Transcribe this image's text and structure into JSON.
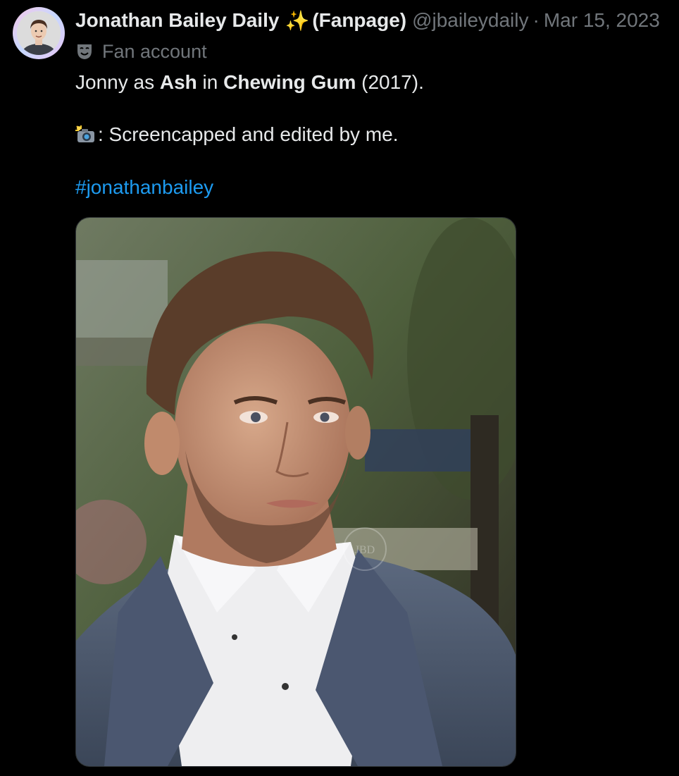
{
  "tweet": {
    "display_name": "Jonathan Bailey Daily",
    "name_emoji": "✨",
    "name_suffix": "(Fanpage)",
    "handle": "@jbaileydaily",
    "separator": "·",
    "date": "Mar 15, 2023",
    "account_label": "Fan account",
    "account_label_icon": "theater-mask-icon",
    "line1": {
      "prefix": "Jonny as ",
      "bold1": "Ash",
      "middle": " in ",
      "bold2": "Chewing Gum",
      "suffix": " (2017)."
    },
    "line2": {
      "icon": "camera-flash-emoji",
      "text": ": Screencapped and edited by me."
    },
    "hashtag": "#jonathanbailey",
    "media": {
      "description_icon": "photo",
      "watermark": "JBD"
    }
  },
  "colors": {
    "background": "#000000",
    "text": "#e7e9ea",
    "secondary": "#71767b",
    "link": "#1d9bf0",
    "border": "#2f3336"
  }
}
